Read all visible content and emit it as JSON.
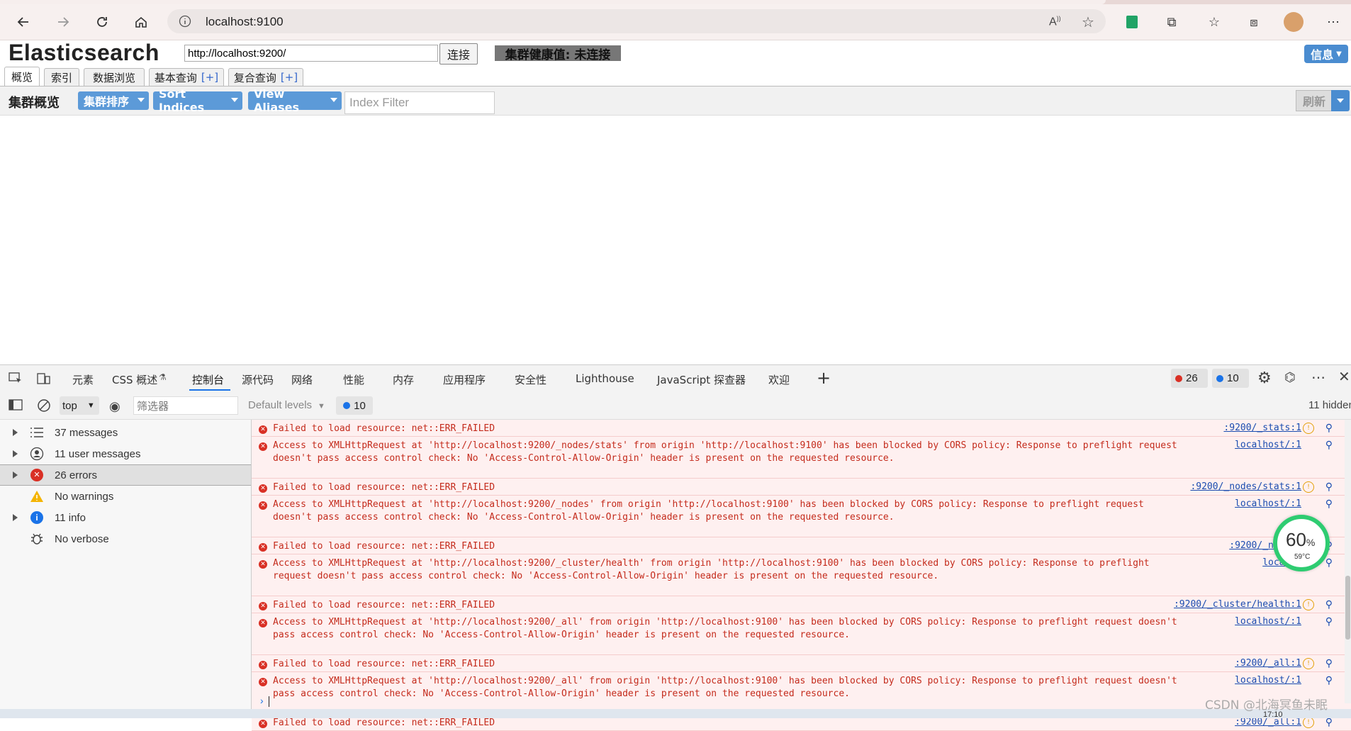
{
  "browser": {
    "url": "localhost:9100",
    "nav": [
      "back",
      "forward",
      "refresh",
      "home"
    ]
  },
  "es": {
    "title": "Elasticsearch",
    "url_value": "http://localhost:9200/",
    "connect_label": "连接",
    "health_label": "集群健康值: 未连接",
    "info_label": "信息",
    "tabs": [
      {
        "label": "概览",
        "plus": ""
      },
      {
        "label": "索引",
        "plus": ""
      },
      {
        "label": "数据浏览",
        "plus": ""
      },
      {
        "label": "基本查询",
        "plus": "[+]"
      },
      {
        "label": "复合查询",
        "plus": "[+]"
      }
    ],
    "overview_label": "集群概览",
    "cluster_sort_label": "集群排序",
    "sort_indices_label": "Sort Indices",
    "view_aliases_label": "View Aliases",
    "index_filter_placeholder": "Index Filter",
    "refresh_label": "刷新"
  },
  "devtools": {
    "tabs": [
      "元素",
      "CSS 概述",
      "控制台",
      "源代码",
      "网络",
      "性能",
      "内存",
      "应用程序",
      "安全性",
      "Lighthouse",
      "JavaScript 探查器",
      "欢迎"
    ],
    "error_count": "26",
    "issue_count": "10",
    "context": "top",
    "filter_placeholder": "筛选器",
    "default_levels": "Default levels",
    "issues_badge": "10",
    "hidden_label": "11 hidden",
    "sidebar": [
      {
        "label": "37 messages",
        "icon": "list-icon",
        "expandable": true
      },
      {
        "label": "11 user messages",
        "icon": "user-icon",
        "expandable": true
      },
      {
        "label": "26 errors",
        "icon": "error-icon",
        "expandable": true
      },
      {
        "label": "No warnings",
        "icon": "warning-icon",
        "expandable": false
      },
      {
        "label": "11 info",
        "icon": "info-icon",
        "expandable": true
      },
      {
        "label": "No verbose",
        "icon": "bug-icon",
        "expandable": false
      }
    ],
    "messages": [
      {
        "l1": "Failed to load resource: net::ERR_FAILED",
        "l2": "",
        "src": ":9200/_stats:1",
        "warn": true
      },
      {
        "l1": "Access to XMLHttpRequest at 'http://localhost:9200/_nodes/stats' from origin 'http://localhost:9100' has been blocked by CORS policy: Response to preflight request",
        "l2": "doesn't pass access control check: No 'Access-Control-Allow-Origin' header is present on the requested resource.",
        "src": "localhost/:1",
        "warn": false
      },
      {
        "l1": "Failed to load resource: net::ERR_FAILED",
        "l2": "",
        "src": ":9200/_nodes/stats:1",
        "warn": true
      },
      {
        "l1": "Access to XMLHttpRequest at 'http://localhost:9200/_nodes' from origin 'http://localhost:9100' has been blocked by CORS policy: Response to preflight request",
        "l2": "doesn't pass access control check: No 'Access-Control-Allow-Origin' header is present on the requested resource.",
        "src": "localhost/:1",
        "warn": false
      },
      {
        "l1": "Failed to load resource: net::ERR_FAILED",
        "l2": "",
        "src": ":9200/_nodes:",
        "warn": false
      },
      {
        "l1": "Access to XMLHttpRequest at 'http://localhost:9200/_cluster/health' from origin 'http://localhost:9100' has been blocked by CORS policy: Response to preflight",
        "l2": "request doesn't pass access control check: No 'Access-Control-Allow-Origin' header is present on the requested resource.",
        "src": "localho",
        "warn": false
      },
      {
        "l1": "Failed to load resource: net::ERR_FAILED",
        "l2": "",
        "src": ":9200/_cluster/health:1",
        "warn": true
      },
      {
        "l1": "Access to XMLHttpRequest at 'http://localhost:9200/_all' from origin 'http://localhost:9100' has been blocked by CORS policy: Response to preflight request doesn't",
        "l2": "pass access control check: No 'Access-Control-Allow-Origin' header is present on the requested resource.",
        "src": "localhost/:1",
        "warn": false
      },
      {
        "l1": "Failed to load resource: net::ERR_FAILED",
        "l2": "",
        "src": ":9200/_all:1",
        "warn": true
      },
      {
        "l1": "Access to XMLHttpRequest at 'http://localhost:9200/_all' from origin 'http://localhost:9100' has been blocked by CORS policy: Response to preflight request doesn't",
        "l2": "pass access control check: No 'Access-Control-Allow-Origin' header is present on the requested resource.",
        "src": "localhost/:1",
        "warn": false
      },
      {
        "l1": "Failed to load resource: net::ERR_FAILED",
        "l2": "",
        "src": ":9200/_all:1",
        "warn": true
      }
    ]
  },
  "overlay": {
    "gauge_percent": "60",
    "gauge_unit": "%",
    "gauge_temp": "59°C",
    "watermark": "CSDN @北海冥鱼未眠",
    "clock": "17:10"
  },
  "colors": {
    "accent": "#4a8cd0",
    "error": "#c42b1c",
    "error_bg": "#fef0f0",
    "gauge": "#2ecc71"
  }
}
